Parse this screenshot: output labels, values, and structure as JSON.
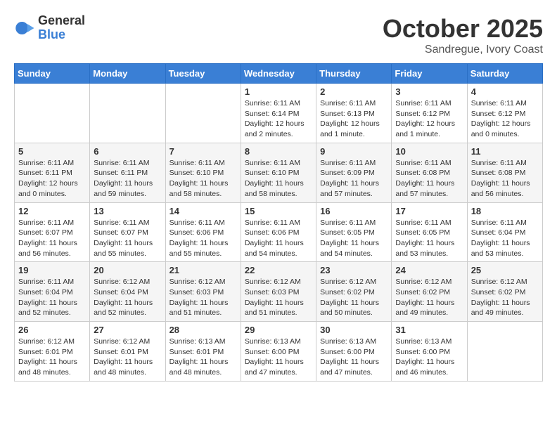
{
  "header": {
    "logo_general": "General",
    "logo_blue": "Blue",
    "month": "October 2025",
    "location": "Sandregue, Ivory Coast"
  },
  "weekdays": [
    "Sunday",
    "Monday",
    "Tuesday",
    "Wednesday",
    "Thursday",
    "Friday",
    "Saturday"
  ],
  "weeks": [
    {
      "days": [
        {
          "num": "",
          "empty": true
        },
        {
          "num": "",
          "empty": true
        },
        {
          "num": "",
          "empty": true
        },
        {
          "num": "1",
          "sunrise": "6:11 AM",
          "sunset": "6:14 PM",
          "daylight": "12 hours and 2 minutes."
        },
        {
          "num": "2",
          "sunrise": "6:11 AM",
          "sunset": "6:13 PM",
          "daylight": "12 hours and 1 minute."
        },
        {
          "num": "3",
          "sunrise": "6:11 AM",
          "sunset": "6:12 PM",
          "daylight": "12 hours and 1 minute."
        },
        {
          "num": "4",
          "sunrise": "6:11 AM",
          "sunset": "6:12 PM",
          "daylight": "12 hours and 0 minutes."
        }
      ]
    },
    {
      "days": [
        {
          "num": "5",
          "sunrise": "6:11 AM",
          "sunset": "6:11 PM",
          "daylight": "12 hours and 0 minutes."
        },
        {
          "num": "6",
          "sunrise": "6:11 AM",
          "sunset": "6:11 PM",
          "daylight": "11 hours and 59 minutes."
        },
        {
          "num": "7",
          "sunrise": "6:11 AM",
          "sunset": "6:10 PM",
          "daylight": "11 hours and 58 minutes."
        },
        {
          "num": "8",
          "sunrise": "6:11 AM",
          "sunset": "6:10 PM",
          "daylight": "11 hours and 58 minutes."
        },
        {
          "num": "9",
          "sunrise": "6:11 AM",
          "sunset": "6:09 PM",
          "daylight": "11 hours and 57 minutes."
        },
        {
          "num": "10",
          "sunrise": "6:11 AM",
          "sunset": "6:08 PM",
          "daylight": "11 hours and 57 minutes."
        },
        {
          "num": "11",
          "sunrise": "6:11 AM",
          "sunset": "6:08 PM",
          "daylight": "11 hours and 56 minutes."
        }
      ]
    },
    {
      "days": [
        {
          "num": "12",
          "sunrise": "6:11 AM",
          "sunset": "6:07 PM",
          "daylight": "11 hours and 56 minutes."
        },
        {
          "num": "13",
          "sunrise": "6:11 AM",
          "sunset": "6:07 PM",
          "daylight": "11 hours and 55 minutes."
        },
        {
          "num": "14",
          "sunrise": "6:11 AM",
          "sunset": "6:06 PM",
          "daylight": "11 hours and 55 minutes."
        },
        {
          "num": "15",
          "sunrise": "6:11 AM",
          "sunset": "6:06 PM",
          "daylight": "11 hours and 54 minutes."
        },
        {
          "num": "16",
          "sunrise": "6:11 AM",
          "sunset": "6:05 PM",
          "daylight": "11 hours and 54 minutes."
        },
        {
          "num": "17",
          "sunrise": "6:11 AM",
          "sunset": "6:05 PM",
          "daylight": "11 hours and 53 minutes."
        },
        {
          "num": "18",
          "sunrise": "6:11 AM",
          "sunset": "6:04 PM",
          "daylight": "11 hours and 53 minutes."
        }
      ]
    },
    {
      "days": [
        {
          "num": "19",
          "sunrise": "6:11 AM",
          "sunset": "6:04 PM",
          "daylight": "11 hours and 52 minutes."
        },
        {
          "num": "20",
          "sunrise": "6:12 AM",
          "sunset": "6:04 PM",
          "daylight": "11 hours and 52 minutes."
        },
        {
          "num": "21",
          "sunrise": "6:12 AM",
          "sunset": "6:03 PM",
          "daylight": "11 hours and 51 minutes."
        },
        {
          "num": "22",
          "sunrise": "6:12 AM",
          "sunset": "6:03 PM",
          "daylight": "11 hours and 51 minutes."
        },
        {
          "num": "23",
          "sunrise": "6:12 AM",
          "sunset": "6:02 PM",
          "daylight": "11 hours and 50 minutes."
        },
        {
          "num": "24",
          "sunrise": "6:12 AM",
          "sunset": "6:02 PM",
          "daylight": "11 hours and 49 minutes."
        },
        {
          "num": "25",
          "sunrise": "6:12 AM",
          "sunset": "6:02 PM",
          "daylight": "11 hours and 49 minutes."
        }
      ]
    },
    {
      "days": [
        {
          "num": "26",
          "sunrise": "6:12 AM",
          "sunset": "6:01 PM",
          "daylight": "11 hours and 48 minutes."
        },
        {
          "num": "27",
          "sunrise": "6:12 AM",
          "sunset": "6:01 PM",
          "daylight": "11 hours and 48 minutes."
        },
        {
          "num": "28",
          "sunrise": "6:13 AM",
          "sunset": "6:01 PM",
          "daylight": "11 hours and 48 minutes."
        },
        {
          "num": "29",
          "sunrise": "6:13 AM",
          "sunset": "6:00 PM",
          "daylight": "11 hours and 47 minutes."
        },
        {
          "num": "30",
          "sunrise": "6:13 AM",
          "sunset": "6:00 PM",
          "daylight": "11 hours and 47 minutes."
        },
        {
          "num": "31",
          "sunrise": "6:13 AM",
          "sunset": "6:00 PM",
          "daylight": "11 hours and 46 minutes."
        },
        {
          "num": "",
          "empty": true
        }
      ]
    }
  ],
  "labels": {
    "sunrise": "Sunrise:",
    "sunset": "Sunset:",
    "daylight": "Daylight hours"
  }
}
